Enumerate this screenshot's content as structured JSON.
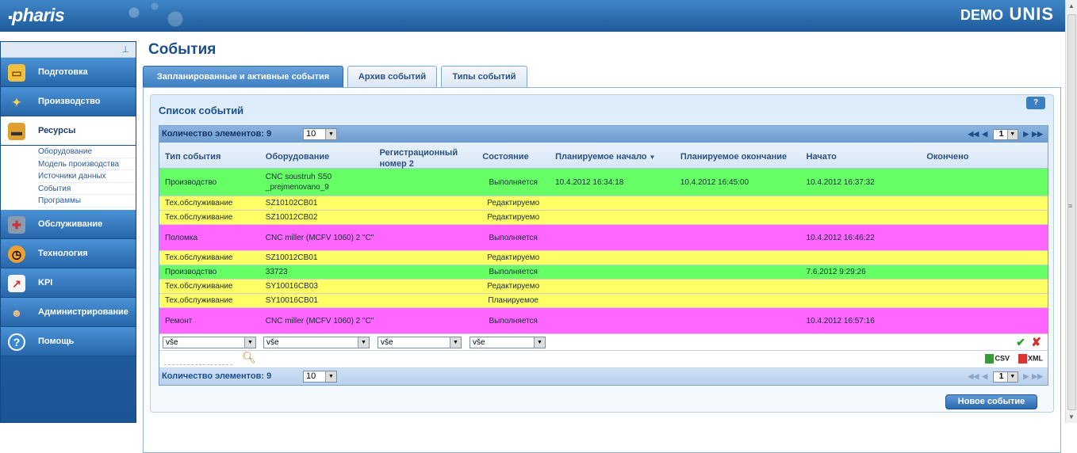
{
  "header": {
    "logo": "pharis",
    "env": "DEMO",
    "brand": "UNIS"
  },
  "sidebar": {
    "pin": "⊥",
    "items": [
      {
        "label": "Подготовка",
        "icon": "book-icon"
      },
      {
        "label": "Производство",
        "icon": "satellite-icon"
      },
      {
        "label": "Ресурсы",
        "icon": "machine-icon"
      },
      {
        "label": "Обслуживание",
        "icon": "tools-icon"
      },
      {
        "label": "Технология",
        "icon": "gauge-icon"
      },
      {
        "label": "KPI",
        "icon": "chart-icon"
      },
      {
        "label": "Администрирование",
        "icon": "users-icon"
      },
      {
        "label": "Помощь",
        "icon": "help-icon"
      }
    ],
    "subitems": [
      "Оборудование",
      "Модель производства",
      "Источники данных",
      "События",
      "Программы"
    ]
  },
  "page": {
    "title": "События"
  },
  "tabs": [
    "Запланированные и активные события",
    "Архив событий",
    "Типы событий"
  ],
  "panel": {
    "title": "Список событий",
    "help": "?"
  },
  "grid": {
    "count_label": "Количество элементов: 9",
    "page_size": "10",
    "page": "1",
    "headers": [
      "Тип события",
      "Оборудование",
      "Регистрационный номер 2",
      "Состояние",
      "Планируемое начало",
      "Планируемое окончание",
      "Начато",
      "Окончено"
    ],
    "rows": [
      {
        "type": "Производство",
        "equip": "CNC soustruh S50 _prejmenovano_9",
        "reg": "",
        "state": "Выполняется",
        "pstart": "10.4.2012 16:34:18",
        "pend": "10.4.2012 16:45:00",
        "started": "10.4.2012 16:37:32",
        "ended": "",
        "color": "#66ff66"
      },
      {
        "type": "Тех.обслуживание",
        "equip": "SZ10102CB01",
        "reg": "",
        "state": "Редактируемо",
        "pstart": "",
        "pend": "",
        "started": "",
        "ended": "",
        "color": "#ffff66"
      },
      {
        "type": "Тех.обслуживание",
        "equip": "SZ10012CB02",
        "reg": "",
        "state": "Редактируемо",
        "pstart": "",
        "pend": "",
        "started": "",
        "ended": "",
        "color": "#ffff66"
      },
      {
        "type": "Поломка",
        "equip": "CNC miller (MCFV 1060) 2 \"C\"",
        "reg": "",
        "state": "Выполняется",
        "pstart": "",
        "pend": "",
        "started": "10.4.2012 16:46:22",
        "ended": "",
        "color": "#ff66ff"
      },
      {
        "type": "Тех.обслуживание",
        "equip": "SZ10012CB01",
        "reg": "",
        "state": "Редактируемо",
        "pstart": "",
        "pend": "",
        "started": "",
        "ended": "",
        "color": "#ffff66"
      },
      {
        "type": "Производство",
        "equip": "33723",
        "reg": "",
        "state": "Выполняется",
        "pstart": "",
        "pend": "",
        "started": "7.6.2012 9:29:26",
        "ended": "",
        "color": "#66ff66"
      },
      {
        "type": "Тех.обслуживание",
        "equip": "SY10016CB03",
        "reg": "",
        "state": "Редактируемо",
        "pstart": "",
        "pend": "",
        "started": "",
        "ended": "",
        "color": "#ffff66"
      },
      {
        "type": "Тех.обслуживание",
        "equip": "SY10016CB01",
        "reg": "",
        "state": "Планируемое",
        "pstart": "",
        "pend": "",
        "started": "",
        "ended": "",
        "color": "#ffff66"
      },
      {
        "type": "Ремонт",
        "equip": "CNC miller (MCFV 1060) 2 \"C\"",
        "reg": "",
        "state": "Выполняется",
        "pstart": "",
        "pend": "",
        "started": "10.4.2012 16:57:16",
        "ended": "",
        "color": "#ff66ff"
      }
    ],
    "filters": [
      "vše",
      "vše",
      "vše",
      "vše"
    ],
    "export": {
      "csv": "CSV",
      "xml": "XML"
    },
    "new_button": "Новое событие"
  }
}
